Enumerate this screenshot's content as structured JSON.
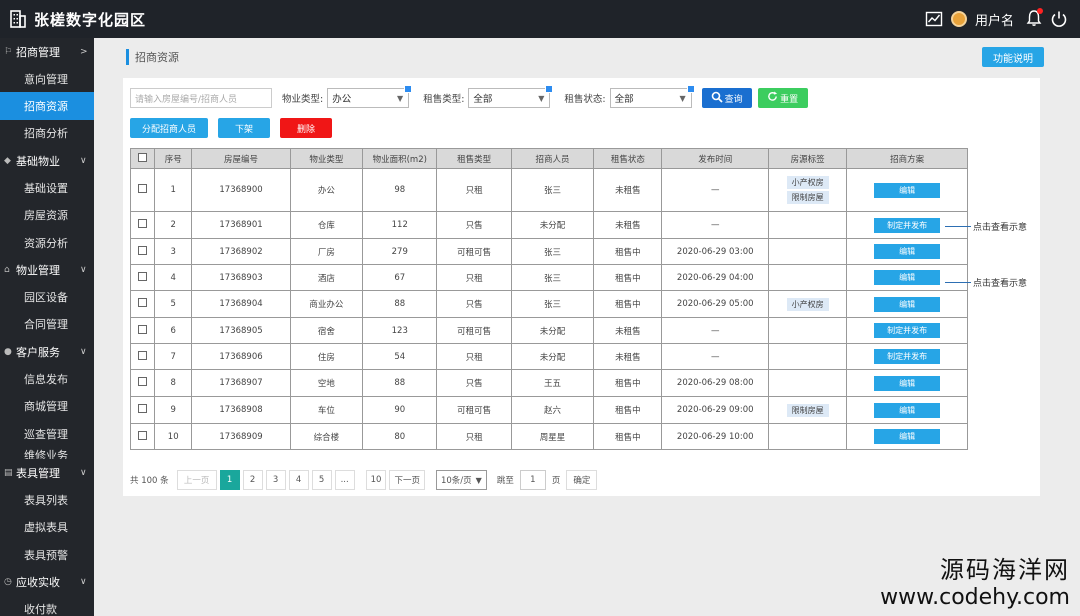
{
  "app": {
    "title": "张槎数字化园区",
    "username": "用户名"
  },
  "sidebar": {
    "groups": [
      {
        "label": "招商管理",
        "items": [
          "意向管理",
          "招商资源",
          "招商分析"
        ],
        "active": 1
      },
      {
        "label": "基础物业",
        "items": [
          "基础设置",
          "房屋资源",
          "资源分析"
        ]
      },
      {
        "label": "物业管理",
        "items": [
          "园区设备",
          "合同管理"
        ]
      },
      {
        "label": "客户服务",
        "items": [
          "信息发布",
          "商城管理",
          "巡查管理",
          "维修业务"
        ]
      },
      {
        "label": "表具管理",
        "items": [
          "表具列表",
          "虚拟表具",
          "表具预警"
        ]
      },
      {
        "label": "应收实收",
        "items": [
          "收付款"
        ]
      }
    ]
  },
  "page": {
    "title": "招商资源",
    "help_label": "功能说明"
  },
  "filters": {
    "search_placeholder": "请输入房屋编号/招商人员",
    "property_type_label": "物业类型:",
    "property_type_value": "办公",
    "lease_type_label": "租售类型:",
    "lease_type_value": "全部",
    "lease_status_label": "租售状态:",
    "lease_status_value": "全部",
    "query_label": "查询",
    "reset_label": "重置"
  },
  "actions": {
    "assign_label": "分配招商人员",
    "offline_label": "下架",
    "delete_label": "删除"
  },
  "table": {
    "headers": [
      "序号",
      "房屋编号",
      "物业类型",
      "物业面积(m2)",
      "租售类型",
      "招商人员",
      "租售状态",
      "发布时间",
      "房源标签",
      "招商方案"
    ],
    "rows": [
      {
        "no": "1",
        "code": "17368900",
        "type": "办公",
        "area": "98",
        "lease": "只租",
        "agent": "张三",
        "status": "未租售",
        "time": "—",
        "tags": [
          "小产权房",
          "限制房屋"
        ],
        "plan": "编辑"
      },
      {
        "no": "2",
        "code": "17368901",
        "type": "仓库",
        "area": "112",
        "lease": "只售",
        "agent": "未分配",
        "status": "未租售",
        "time": "—",
        "tags": [],
        "plan": "制定并发布"
      },
      {
        "no": "3",
        "code": "17368902",
        "type": "厂房",
        "area": "279",
        "lease": "可租可售",
        "agent": "张三",
        "status": "租售中",
        "time": "2020-06-29  03:00",
        "tags": [],
        "plan": "编辑"
      },
      {
        "no": "4",
        "code": "17368903",
        "type": "酒店",
        "area": "67",
        "lease": "只租",
        "agent": "张三",
        "status": "租售中",
        "time": "2020-06-29  04:00",
        "tags": [],
        "plan": "编辑"
      },
      {
        "no": "5",
        "code": "17368904",
        "type": "商业办公",
        "area": "88",
        "lease": "只售",
        "agent": "张三",
        "status": "租售中",
        "time": "2020-06-29  05:00",
        "tags": [
          "小产权房"
        ],
        "plan": "编辑"
      },
      {
        "no": "6",
        "code": "17368905",
        "type": "宿舍",
        "area": "123",
        "lease": "可租可售",
        "agent": "未分配",
        "status": "未租售",
        "time": "—",
        "tags": [],
        "plan": "制定并发布"
      },
      {
        "no": "7",
        "code": "17368906",
        "type": "住房",
        "area": "54",
        "lease": "只租",
        "agent": "未分配",
        "status": "未租售",
        "time": "—",
        "tags": [],
        "plan": "制定并发布"
      },
      {
        "no": "8",
        "code": "17368907",
        "type": "空地",
        "area": "88",
        "lease": "只售",
        "agent": "王五",
        "status": "租售中",
        "time": "2020-06-29  08:00",
        "tags": [],
        "plan": "编辑"
      },
      {
        "no": "9",
        "code": "17368908",
        "type": "车位",
        "area": "90",
        "lease": "可租可售",
        "agent": "赵六",
        "status": "租售中",
        "time": "2020-06-29  09:00",
        "tags": [
          "限制房屋"
        ],
        "plan": "编辑"
      },
      {
        "no": "10",
        "code": "17368909",
        "type": "综合楼",
        "area": "80",
        "lease": "只租",
        "agent": "周星星",
        "status": "租售中",
        "time": "2020-06-29  10:00",
        "tags": [],
        "plan": "编辑"
      }
    ]
  },
  "callouts": [
    "点击查看示意",
    "点击查看示意"
  ],
  "pagination": {
    "total": "共 100 条",
    "prev": "上一页",
    "pages": [
      "1",
      "2",
      "3",
      "4",
      "5",
      "...",
      "10"
    ],
    "active_index": 0,
    "next": "下一页",
    "page_size": "10条/页",
    "goto_label": "跳至",
    "goto_value": "1",
    "page_unit": "页",
    "confirm": "确定"
  },
  "watermark": {
    "line1": "源码海洋网",
    "line2": "www.codehy.com"
  }
}
